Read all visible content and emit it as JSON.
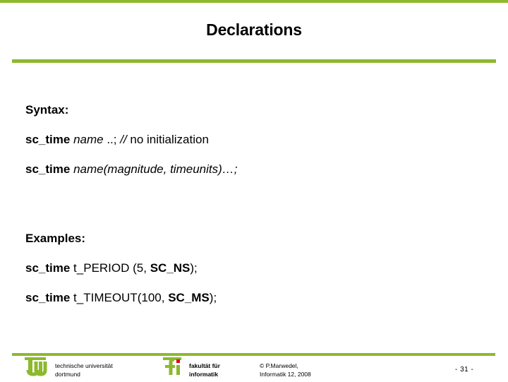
{
  "theme": {
    "accent_green": "#8CB92E",
    "accent_red": "#E2001A",
    "background": "#ffffff",
    "text": "#000000"
  },
  "header": {
    "title": "Declarations"
  },
  "content": {
    "syntax_heading": "Syntax:",
    "syntax_lines": [
      {
        "parts": [
          {
            "text": "sc_time",
            "style": "bold"
          },
          {
            "text": " ",
            "style": "regular"
          },
          {
            "text": "name",
            "style": "italic"
          },
          {
            "text": " ..; ",
            "style": "regular"
          },
          {
            "text": "//",
            "style": "italic"
          },
          {
            "text": " no initialization",
            "style": "regular"
          }
        ]
      },
      {
        "parts": [
          {
            "text": "sc_time",
            "style": "bold"
          },
          {
            "text": " ",
            "style": "regular"
          },
          {
            "text": "name(magnitude, timeunits)…;",
            "style": "italic"
          }
        ]
      }
    ],
    "examples_heading": "Examples:",
    "example_lines": [
      {
        "parts": [
          {
            "text": "sc_time",
            "style": "bold"
          },
          {
            "text": " t_PERIOD (5, ",
            "style": "regular"
          },
          {
            "text": "SC_NS",
            "style": "bold"
          },
          {
            "text": ");",
            "style": "regular"
          }
        ]
      },
      {
        "parts": [
          {
            "text": "sc_time",
            "style": "bold"
          },
          {
            "text": " t_TIMEOUT(100, ",
            "style": "regular"
          },
          {
            "text": "SC_MS",
            "style": "bold"
          },
          {
            "text": ");",
            "style": "regular"
          }
        ]
      }
    ]
  },
  "footer": {
    "logo_tu_alt": "tu",
    "logo_fi_alt": "fi",
    "university_line1": "technische universität",
    "university_line2": "dortmund",
    "faculty_line1": "fakultät für",
    "faculty_line2": "informatik",
    "copyright_line1": "© P.Marwedel,",
    "copyright_line2": "Informatik 12,  2008",
    "page_number": "-  31 -"
  }
}
